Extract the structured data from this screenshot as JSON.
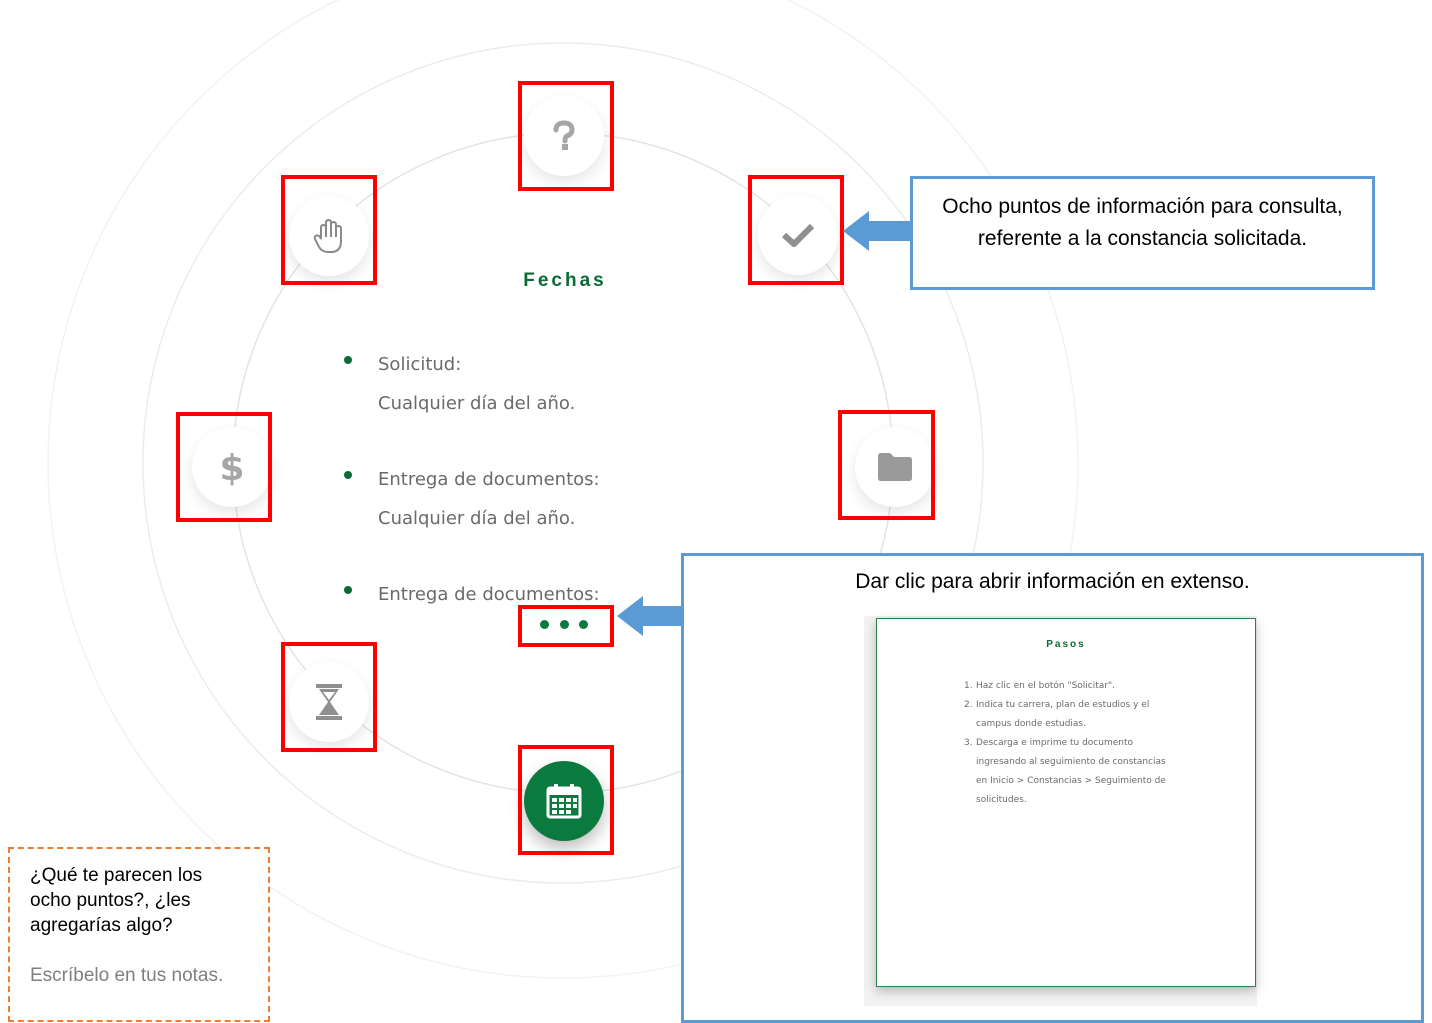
{
  "colors": {
    "brand_green": "#0b7a3e",
    "highlight_red": "#ff0000",
    "callout_blue": "#5b9bd5",
    "note_orange": "#ed7d31",
    "icon_gray": "#a6a6a6"
  },
  "wheel": {
    "nodes": [
      {
        "icon": "question-icon"
      },
      {
        "icon": "check-icon"
      },
      {
        "icon": "folder-icon"
      },
      {
        "icon": "calendar-icon",
        "active": true
      },
      {
        "icon": "hourglass-icon"
      },
      {
        "icon": "dollar-icon"
      },
      {
        "icon": "hand-icon"
      }
    ],
    "panel": {
      "title": "Fechas",
      "items": [
        {
          "label": "Solicitud:",
          "value": "Cualquier día del año."
        },
        {
          "label": "Entrega de documentos:",
          "value": "Cualquier día del año."
        },
        {
          "label": "Entrega de documentos:"
        }
      ],
      "more_icon": "ellipsis-icon"
    }
  },
  "callouts": {
    "points": "Ocho puntos de información para consulta, referente a la constancia solicitada.",
    "expand": "Dar clic para abrir información en extenso."
  },
  "preview": {
    "title": "Pasos",
    "steps": [
      {
        "num": "1.",
        "lines": [
          "Haz clic en el botón \"Solicitar\"."
        ]
      },
      {
        "num": "2.",
        "lines": [
          "Indica tu carrera, plan de estudios y el",
          "campus donde estudias."
        ]
      },
      {
        "num": "3.",
        "lines": [
          "Descarga e imprime tu documento",
          "ingresando al seguimiento de constancias",
          "en Inicio > Constancias > Seguimiento de",
          "solicitudes."
        ]
      }
    ]
  },
  "note": {
    "question": "¿Qué te parecen los ocho puntos?, ¿les agregarías algo?",
    "hint": "Escríbelo en tus notas."
  }
}
